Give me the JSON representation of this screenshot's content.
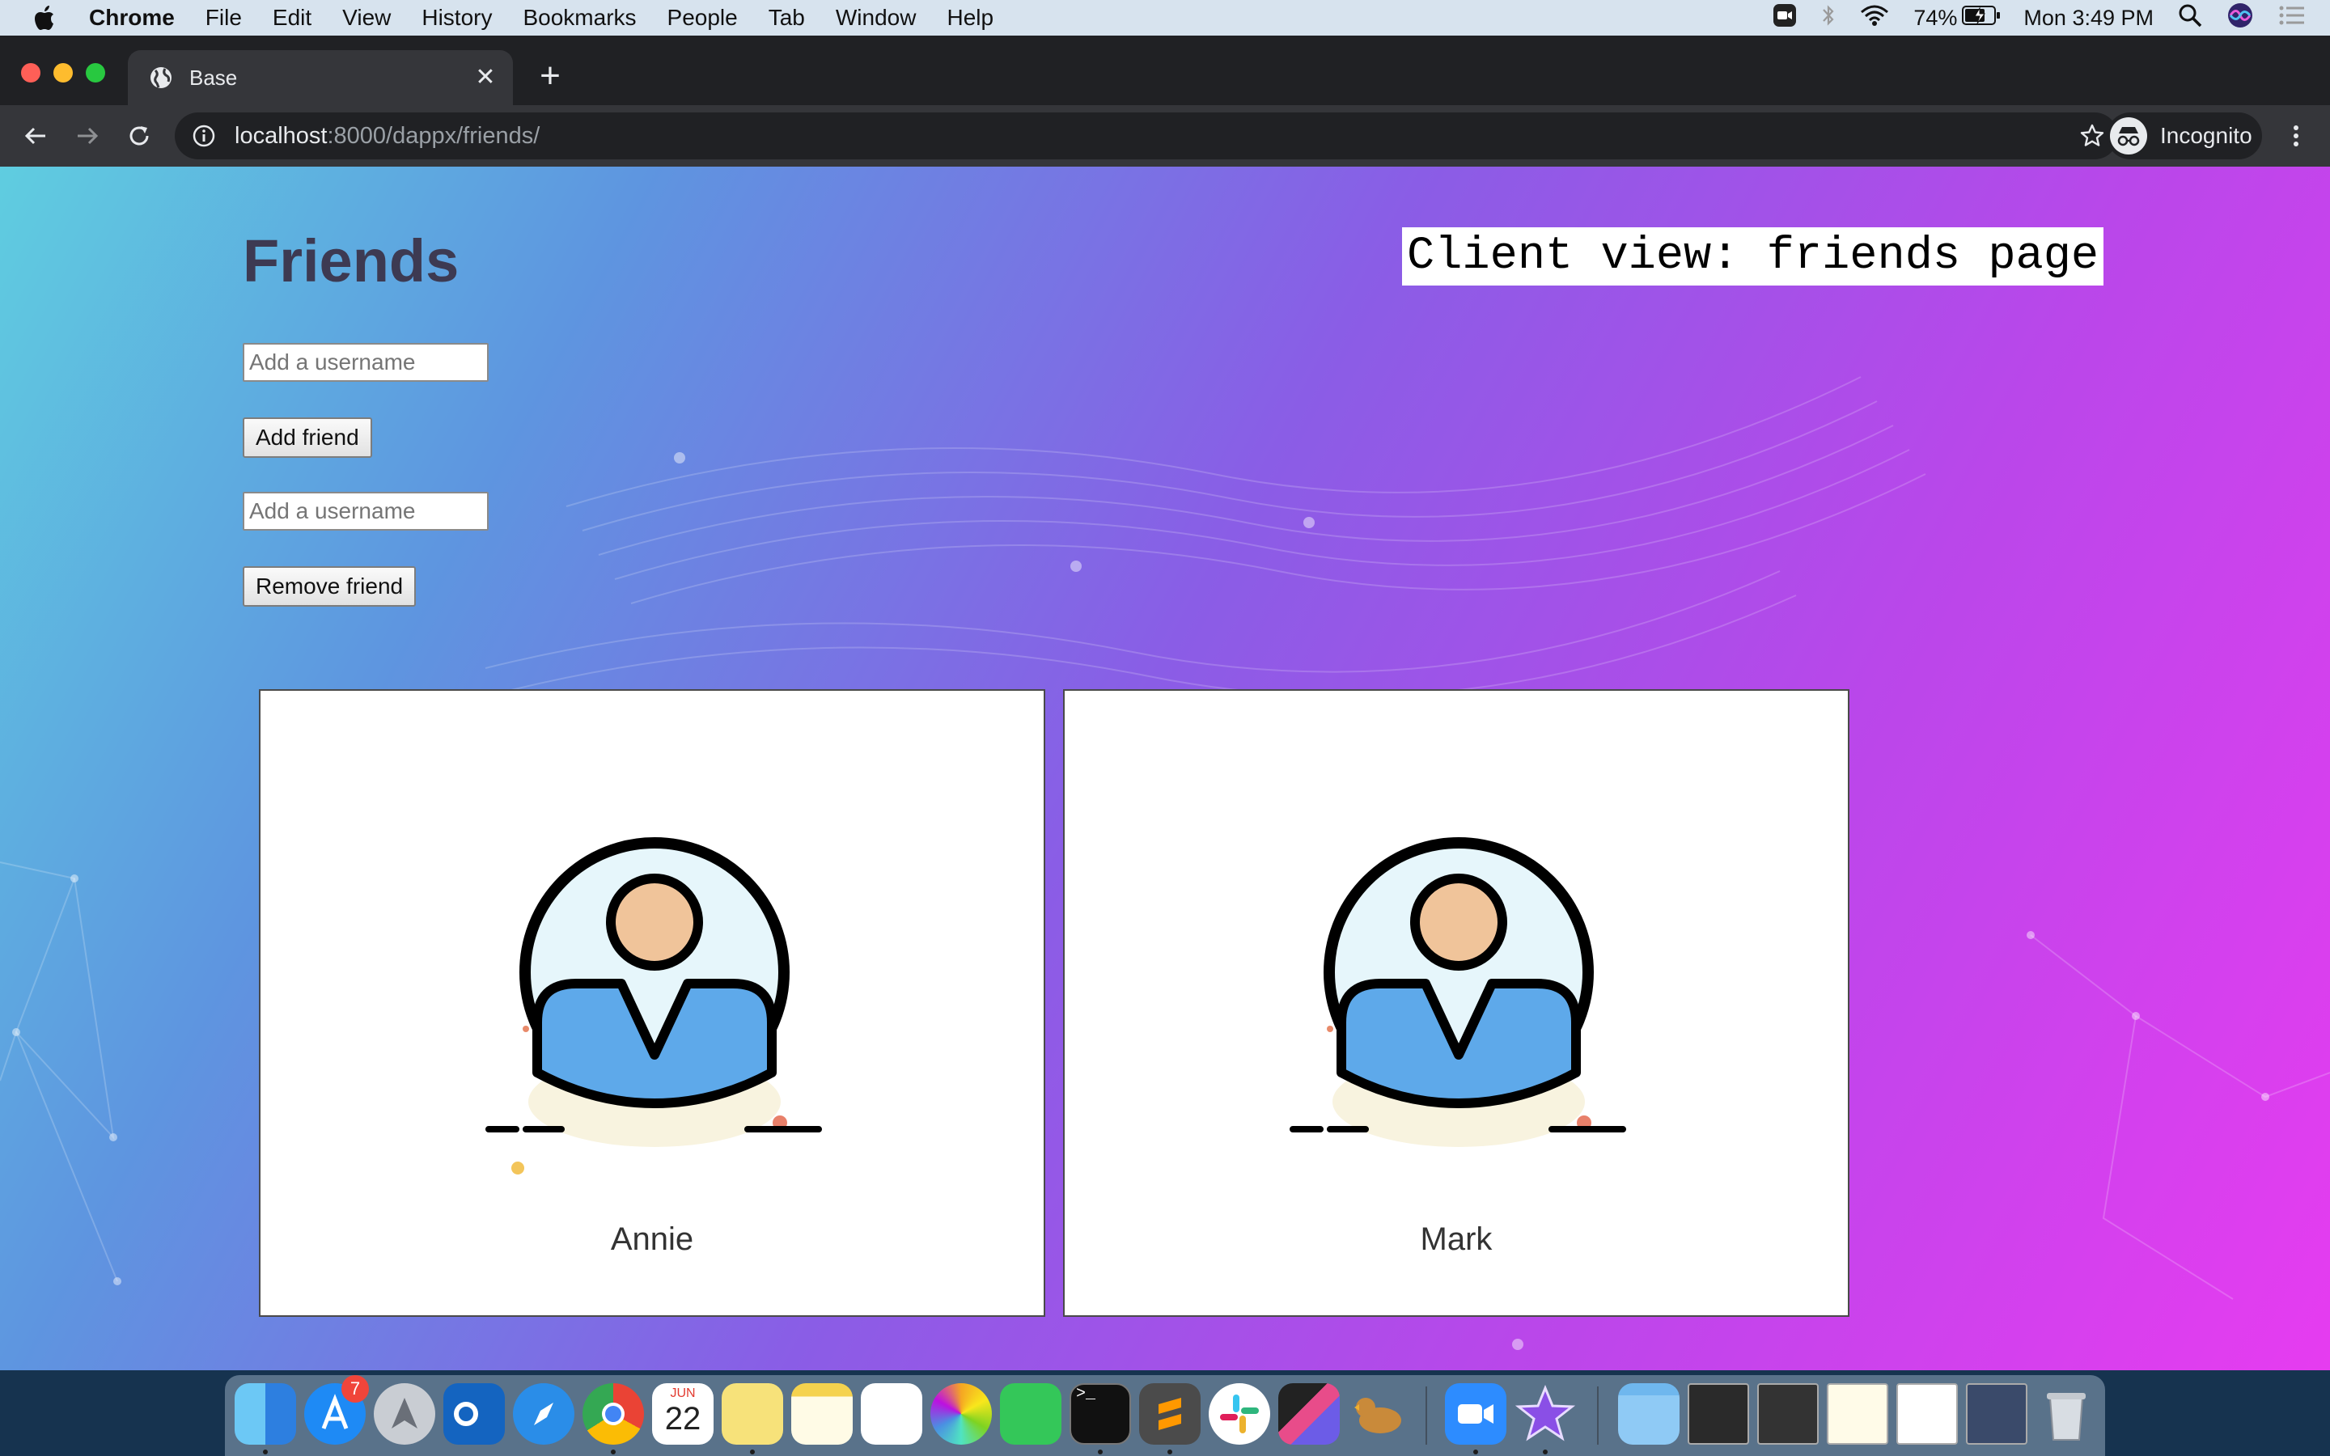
{
  "menubar": {
    "app_name": "Chrome",
    "items": [
      "File",
      "Edit",
      "View",
      "History",
      "Bookmarks",
      "People",
      "Tab",
      "Window",
      "Help"
    ],
    "battery": "74%",
    "clock": "Mon 3:49 PM"
  },
  "browser": {
    "tab_title": "Base",
    "url_host": "localhost",
    "url_rest": ":8000/dappx/friends/",
    "incognito_label": "Incognito"
  },
  "page": {
    "title": "Friends",
    "client_label": "Client view: friends page",
    "add_input_placeholder": "Add a username",
    "add_button": "Add friend",
    "remove_input_placeholder": "Add a username",
    "remove_button": "Remove friend",
    "friends": [
      {
        "name": "Annie"
      },
      {
        "name": "Mark"
      }
    ]
  },
  "dock": {
    "app_store_badge": "7",
    "calendar_month": "JUN",
    "calendar_day": "22",
    "apps": [
      "Finder",
      "App Store",
      "Launchpad",
      "Outlook",
      "Safari",
      "Chrome",
      "Calendar",
      "Stickies",
      "Notes",
      "Reminders",
      "Photos",
      "FaceTime",
      "Terminal",
      "Sublime Text",
      "Slack",
      "Final Cut Pro",
      "Cyberduck",
      "Zoom",
      "iMovie",
      "Folder",
      "Window 1",
      "Window 2",
      "Window 3",
      "Window 4",
      "Window 5",
      "Trash"
    ]
  },
  "colors": {
    "gradient_start": "#5fcde0",
    "gradient_end": "#e63cf0",
    "avatar_head": "#f0c49a",
    "avatar_body": "#5ea9ea",
    "avatar_bg": "#e6f6fb"
  }
}
